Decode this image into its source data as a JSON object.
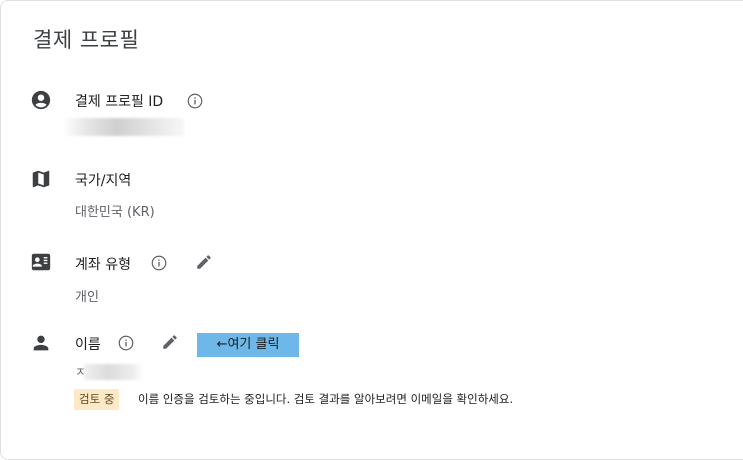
{
  "header": {
    "title": "결제 프로필"
  },
  "rows": {
    "profile_id": {
      "label": "결제 프로필 ID",
      "icon": "account-circle-icon"
    },
    "country": {
      "label": "국가/지역",
      "value": "대한민국 (KR)",
      "icon": "map-icon"
    },
    "account_type": {
      "label": "계좌 유형",
      "value": "개인",
      "icon": "id-card-icon"
    },
    "name": {
      "label": "이름",
      "value_initial": "ㅈ",
      "icon": "person-icon",
      "status_badge": "검토 중",
      "status_message": "이름 인증을 검토하는 중입니다. 검토 결과를 알아보려면 이메일을 확인하세요."
    }
  },
  "annotation": {
    "callout_text": "←여기 클릭"
  },
  "colors": {
    "icon": "#3c4043",
    "callout_bg": "#6db8e8",
    "badge_bg": "#fde9c8"
  }
}
